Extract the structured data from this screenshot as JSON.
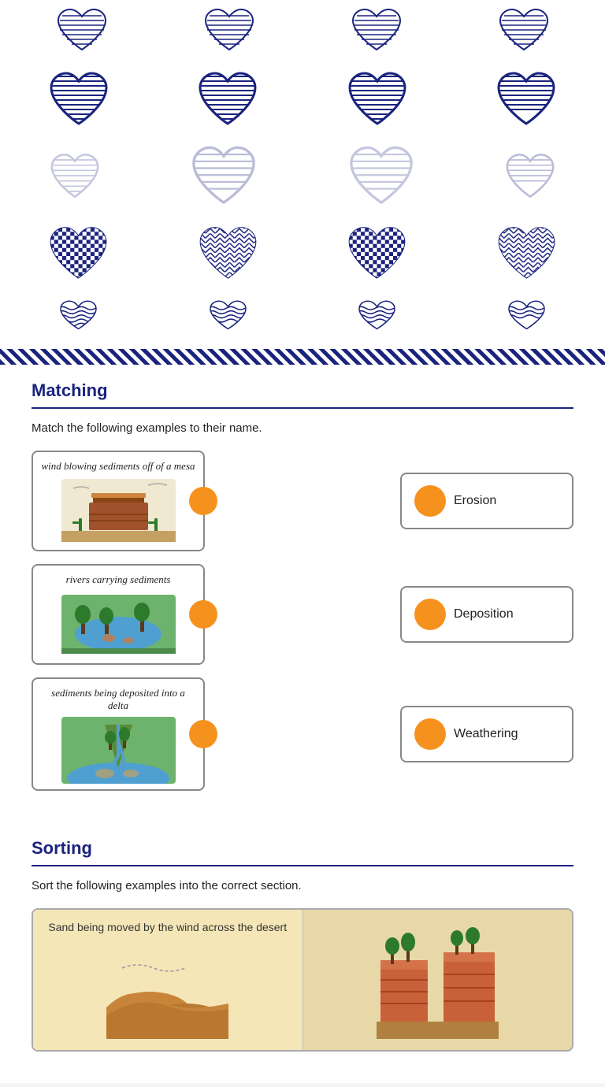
{
  "header": {
    "hearts_rows": 5
  },
  "matching": {
    "title": "Matching",
    "instruction": "Match the following examples to their name.",
    "left_cards": [
      {
        "id": "wind-mesa",
        "text": "wind blowing sediments off of a mesa",
        "image_type": "mesa"
      },
      {
        "id": "rivers-sediments",
        "text": "rivers carrying sediments",
        "image_type": "river"
      },
      {
        "id": "delta-deposit",
        "text": "sediments being deposited into a delta",
        "image_type": "delta"
      }
    ],
    "right_cards": [
      {
        "id": "erosion",
        "label": "Erosion"
      },
      {
        "id": "deposition",
        "label": "Deposition"
      },
      {
        "id": "weathering",
        "label": "Weathering"
      }
    ]
  },
  "sorting": {
    "title": "Sorting",
    "instruction": "Sort the following examples into the correct section.",
    "cards": [
      {
        "text": "Sand being moved by the wind across the desert",
        "bg": "yellow"
      },
      {
        "text": "",
        "bg": "beige"
      }
    ]
  }
}
